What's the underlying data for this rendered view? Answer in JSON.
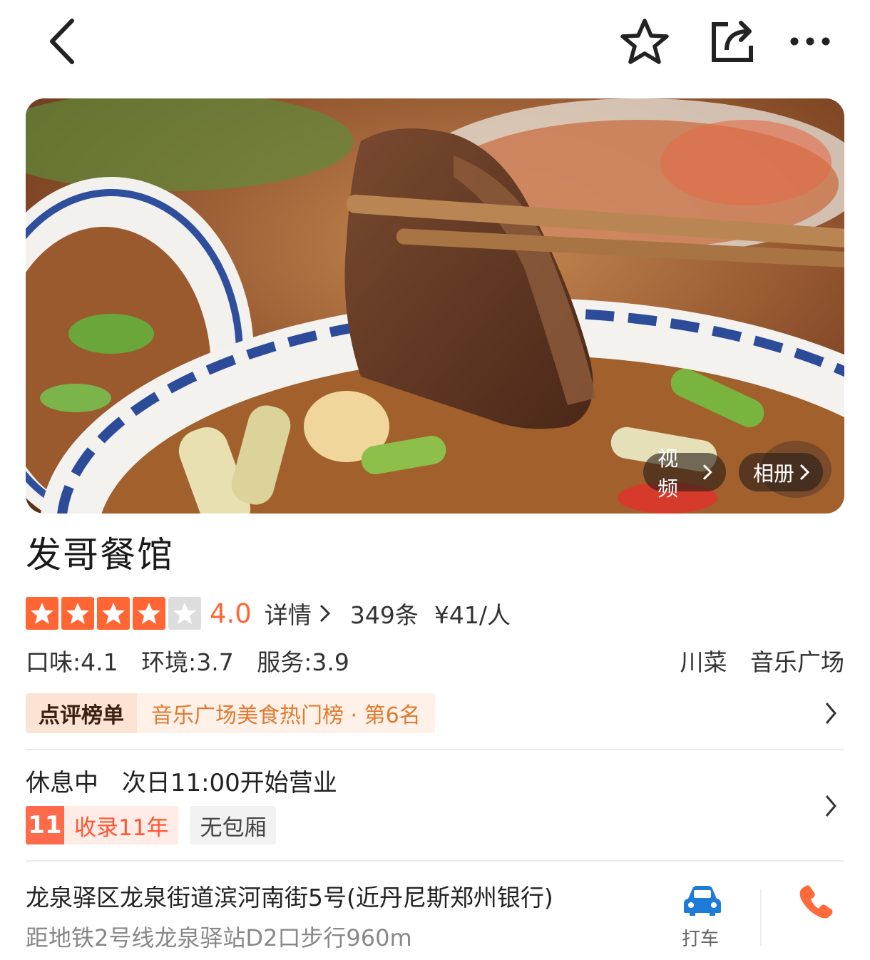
{
  "header": {
    "back_icon": "back-arrow-icon",
    "favorite_icon": "star-outline-icon",
    "share_icon": "share-icon",
    "more_icon": "more-dots-icon"
  },
  "hero": {
    "video_label": "视频",
    "album_label": "相册"
  },
  "restaurant": {
    "name": "发哥餐馆",
    "rating": {
      "stars_filled": 4,
      "stars_total": 5,
      "score": "4.0",
      "detail_label": "详情",
      "review_count": "349条",
      "price": "¥41/人"
    },
    "subscores": {
      "taste": "口味:4.1",
      "environment": "环境:3.7",
      "service": "服务:3.9"
    },
    "tags": [
      "川菜",
      "音乐广场"
    ],
    "ranking": {
      "badge": "点评榜单",
      "text": "音乐广场美食热门榜 · 第6名"
    },
    "hours": {
      "status": "休息中",
      "next_open": "次日11:00开始营业"
    },
    "badges": {
      "years_number": "11",
      "years_label": "收录11年",
      "room": "无包厢"
    },
    "address": "龙泉驿区龙泉街道滨河南街5号(近丹尼斯郑州银行)",
    "metro": "距地铁2号线龙泉驿站D2口步行960m",
    "taxi_label": "打车"
  },
  "colors": {
    "accent": "#ff6633",
    "taxi_blue": "#1e7bd8",
    "rank_orange": "#e07a30"
  }
}
